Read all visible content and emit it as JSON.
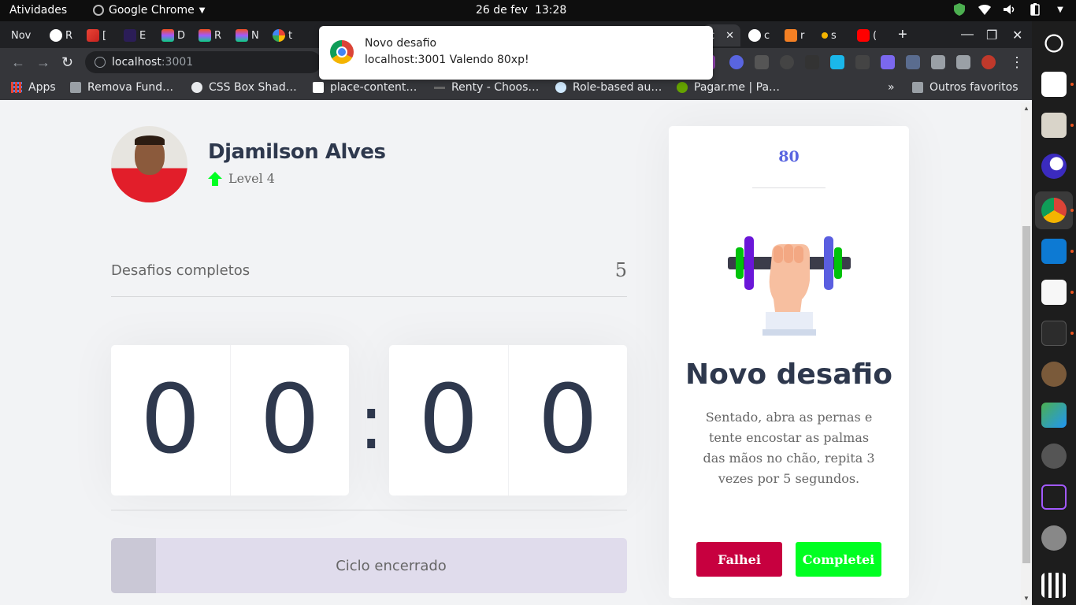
{
  "system_bar": {
    "activities": "Atividades",
    "app_name": "Google Chrome",
    "date": "26 de fev",
    "time": "13:28"
  },
  "browser": {
    "tabs": [
      {
        "label": "Nov",
        "favicon": "chrome-icon"
      },
      {
        "label": "R",
        "favicon": "github-icon"
      },
      {
        "label": "[",
        "favicon": "gmail-icon"
      },
      {
        "label": "E",
        "favicon": "vercel-icon"
      },
      {
        "label": "D",
        "favicon": "figma-icon"
      },
      {
        "label": "R",
        "favicon": "figma-icon"
      },
      {
        "label": "N",
        "favicon": "figma-icon"
      },
      {
        "label": "t",
        "favicon": "google-icon"
      },
      {
        "label": "c",
        "favicon": "localhost-icon"
      },
      {
        "label": "c",
        "favicon": "codepen-icon"
      },
      {
        "label": "r",
        "favicon": "stackoverflow-icon"
      },
      {
        "label": "s",
        "favicon": "site-icon"
      },
      {
        "label": "(",
        "favicon": "youtube-icon"
      }
    ],
    "url_host": "localhost",
    "url_port": ":3001",
    "bookmarks": [
      {
        "label": "Apps",
        "icon": "apps-grid-icon"
      },
      {
        "label": "Remova Fund…",
        "icon": "layers-icon"
      },
      {
        "label": "CSS Box Shad…",
        "icon": "globe-icon"
      },
      {
        "label": "place-content…",
        "icon": "mdn-icon"
      },
      {
        "label": "Renty - Choos…",
        "icon": "renty-icon"
      },
      {
        "label": "Role-based au…",
        "icon": "auth-icon"
      },
      {
        "label": "Pagar.me | Pa…",
        "icon": "pagarme-icon"
      }
    ],
    "other_bookmarks": "Outros favoritos"
  },
  "notification": {
    "title": "Novo desafio",
    "body": "localhost:3001  Valendo 80xp!"
  },
  "profile": {
    "name": "Djamilson Alves",
    "level_text": "Level 4"
  },
  "completed": {
    "label": "Desafios completos",
    "count": "5"
  },
  "countdown": {
    "minute_left": "0",
    "minute_right": "0",
    "separator": ":",
    "second_left": "0",
    "second_right": "0"
  },
  "cycle": {
    "label": "Ciclo encerrado",
    "progress": 0.087
  },
  "challenge": {
    "xp": "80",
    "icon": "dumbbell-arm-icon",
    "title": "Novo desafio",
    "description": "Sentado, abra as pernas e tente encostar as palmas das mãos no chão, repita 3 vezes por 5 segundos.",
    "fail_label": "Falhei",
    "success_label": "Completei"
  },
  "colors": {
    "accent": "#5965e0",
    "text_title": "#2e384d",
    "fail": "#c7003f",
    "success": "#00ff22"
  }
}
